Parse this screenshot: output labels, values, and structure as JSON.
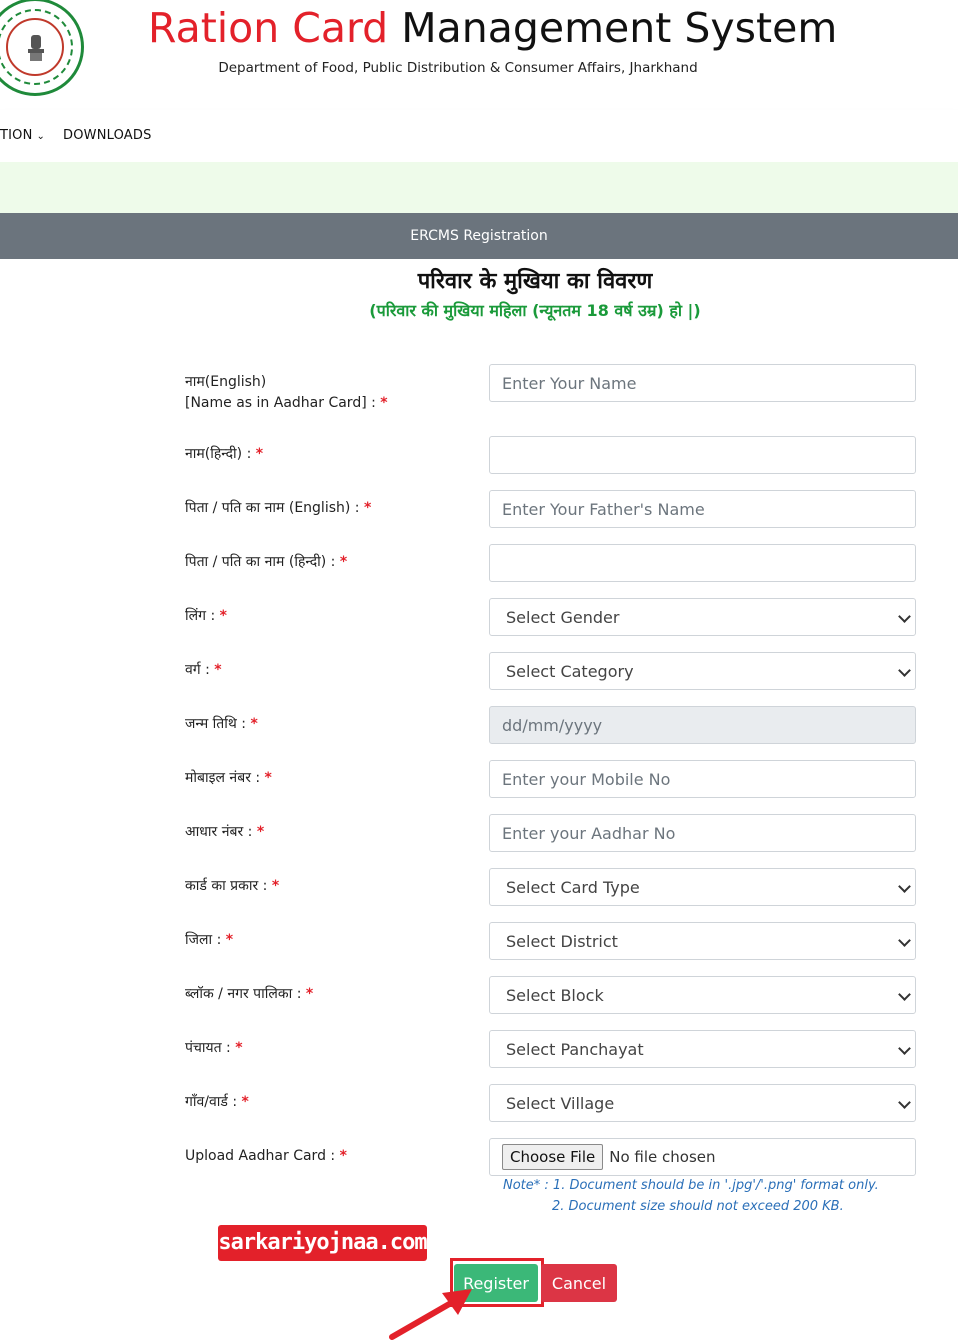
{
  "header": {
    "title_part1": "Ration Card",
    "title_part2": "Management System",
    "subtitle": "Department of Food, Public Distribution & Consumer Affairs, Jharkhand"
  },
  "nav": {
    "items": [
      {
        "label": "TION",
        "has_dropdown": true
      },
      {
        "label": "DOWNLOADS",
        "has_dropdown": false
      }
    ]
  },
  "section": {
    "title": "ERCMS Registration",
    "heading": "परिवार के मुखिया का विवरण",
    "subheading": "(परिवार की मुखिया महिला (न्यूनतम 18 वर्ष उम्र) हो |)"
  },
  "fields": {
    "name_en": {
      "label_line1": "नाम(English)",
      "label_line2": "[Name as in Aadhar Card] : ",
      "placeholder": "Enter Your Name",
      "required": "*"
    },
    "name_hi": {
      "label": "नाम(हिन्दी) : ",
      "placeholder": "",
      "required": "*"
    },
    "father_en": {
      "label": "पिता / पति का नाम (English) : ",
      "placeholder": "Enter Your Father's Name",
      "required": "*"
    },
    "father_hi": {
      "label": "पिता / पति का नाम (हिन्दी) : ",
      "placeholder": "",
      "required": "*"
    },
    "gender": {
      "label": "लिंग : ",
      "selected": "Select Gender",
      "required": "*"
    },
    "category": {
      "label": "वर्ग : ",
      "selected": "Select Category",
      "required": "*"
    },
    "dob": {
      "label": "जन्म तिथि : ",
      "placeholder": "dd/mm/yyyy",
      "required": "*"
    },
    "mobile": {
      "label": "मोबाइल नंबर : ",
      "placeholder": "Enter your Mobile No",
      "required": "*"
    },
    "aadhar": {
      "label": "आधार नंबर : ",
      "placeholder": "Enter your Aadhar No",
      "required": "*"
    },
    "card_type": {
      "label": "कार्ड का प्रकार : ",
      "selected": "Select Card Type",
      "required": "*"
    },
    "district": {
      "label": "जिला : ",
      "selected": "Select District",
      "required": "*"
    },
    "block": {
      "label": "ब्लॉक / नगर पालिका : ",
      "selected": "Select Block",
      "required": "*"
    },
    "panchayat": {
      "label": "पंचायत : ",
      "selected": "Select Panchayat",
      "required": "*"
    },
    "village": {
      "label": "गाँव/वार्ड : ",
      "selected": "Select Village",
      "required": "*"
    },
    "upload": {
      "label": "Upload Aadhar Card : ",
      "button": "Choose File",
      "status": "No file chosen",
      "required": "*"
    }
  },
  "note": {
    "line1": "Note* : 1. Document should be in '.jpg'/'.png' format only.",
    "line2": "2. Document size should not exceed 200 KB."
  },
  "watermark": "sarkariyojnaa.com",
  "buttons": {
    "register": "Register",
    "cancel": "Cancel"
  },
  "colors": {
    "brand_red": "#e3212a",
    "accent_green": "#1a9a3a",
    "register_green": "#3bb878",
    "cancel_red": "#dc3545",
    "section_bar": "#6b747d"
  }
}
